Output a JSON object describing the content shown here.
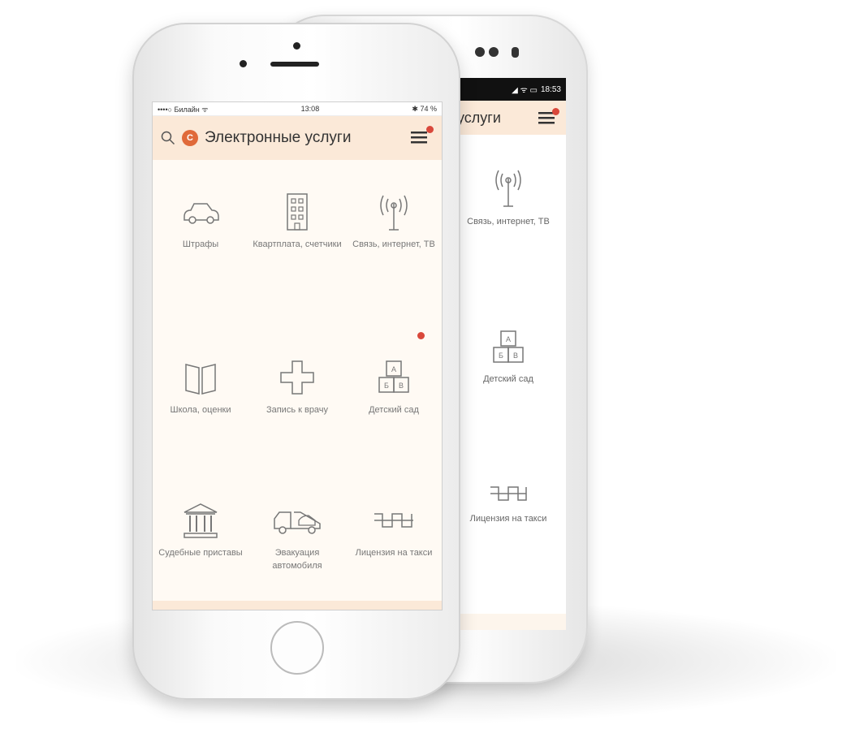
{
  "ios_status": {
    "carrier": "••••○ Билайн ᯤ",
    "time": "13:08",
    "battery": "✱ 74 %"
  },
  "android_status": {
    "time": "18:53"
  },
  "app": {
    "title": "Электронные услуги",
    "title_partial": "услуги"
  },
  "services": [
    {
      "label": "Штрафы",
      "icon": "car-icon"
    },
    {
      "label": "Квартплата, счетчики",
      "icon": "building-icon"
    },
    {
      "label": "Связь, интернет, ТВ",
      "icon": "antenna-icon"
    },
    {
      "label": "Школа, оценки",
      "icon": "book-icon"
    },
    {
      "label": "Запись к врачу",
      "icon": "medical-cross-icon"
    },
    {
      "label": "Детский сад",
      "icon": "kindergarten-blocks-icon"
    },
    {
      "label": "Судебные приставы",
      "icon": "court-building-icon"
    },
    {
      "label": "Эвакуация автомобиля",
      "icon": "tow-truck-icon"
    },
    {
      "label": "Лицензия на такси",
      "icon": "taxi-checker-icon"
    }
  ],
  "android_services": [
    {
      "label": "Связь, интернет, ТВ"
    },
    {
      "label": "Детский сад"
    },
    {
      "label": "Лицензия на такси"
    }
  ],
  "colors": {
    "appbar": "#fbe9d8",
    "accent": "#e06a3a",
    "badge": "#d9483b",
    "icon_stroke": "#777777"
  }
}
